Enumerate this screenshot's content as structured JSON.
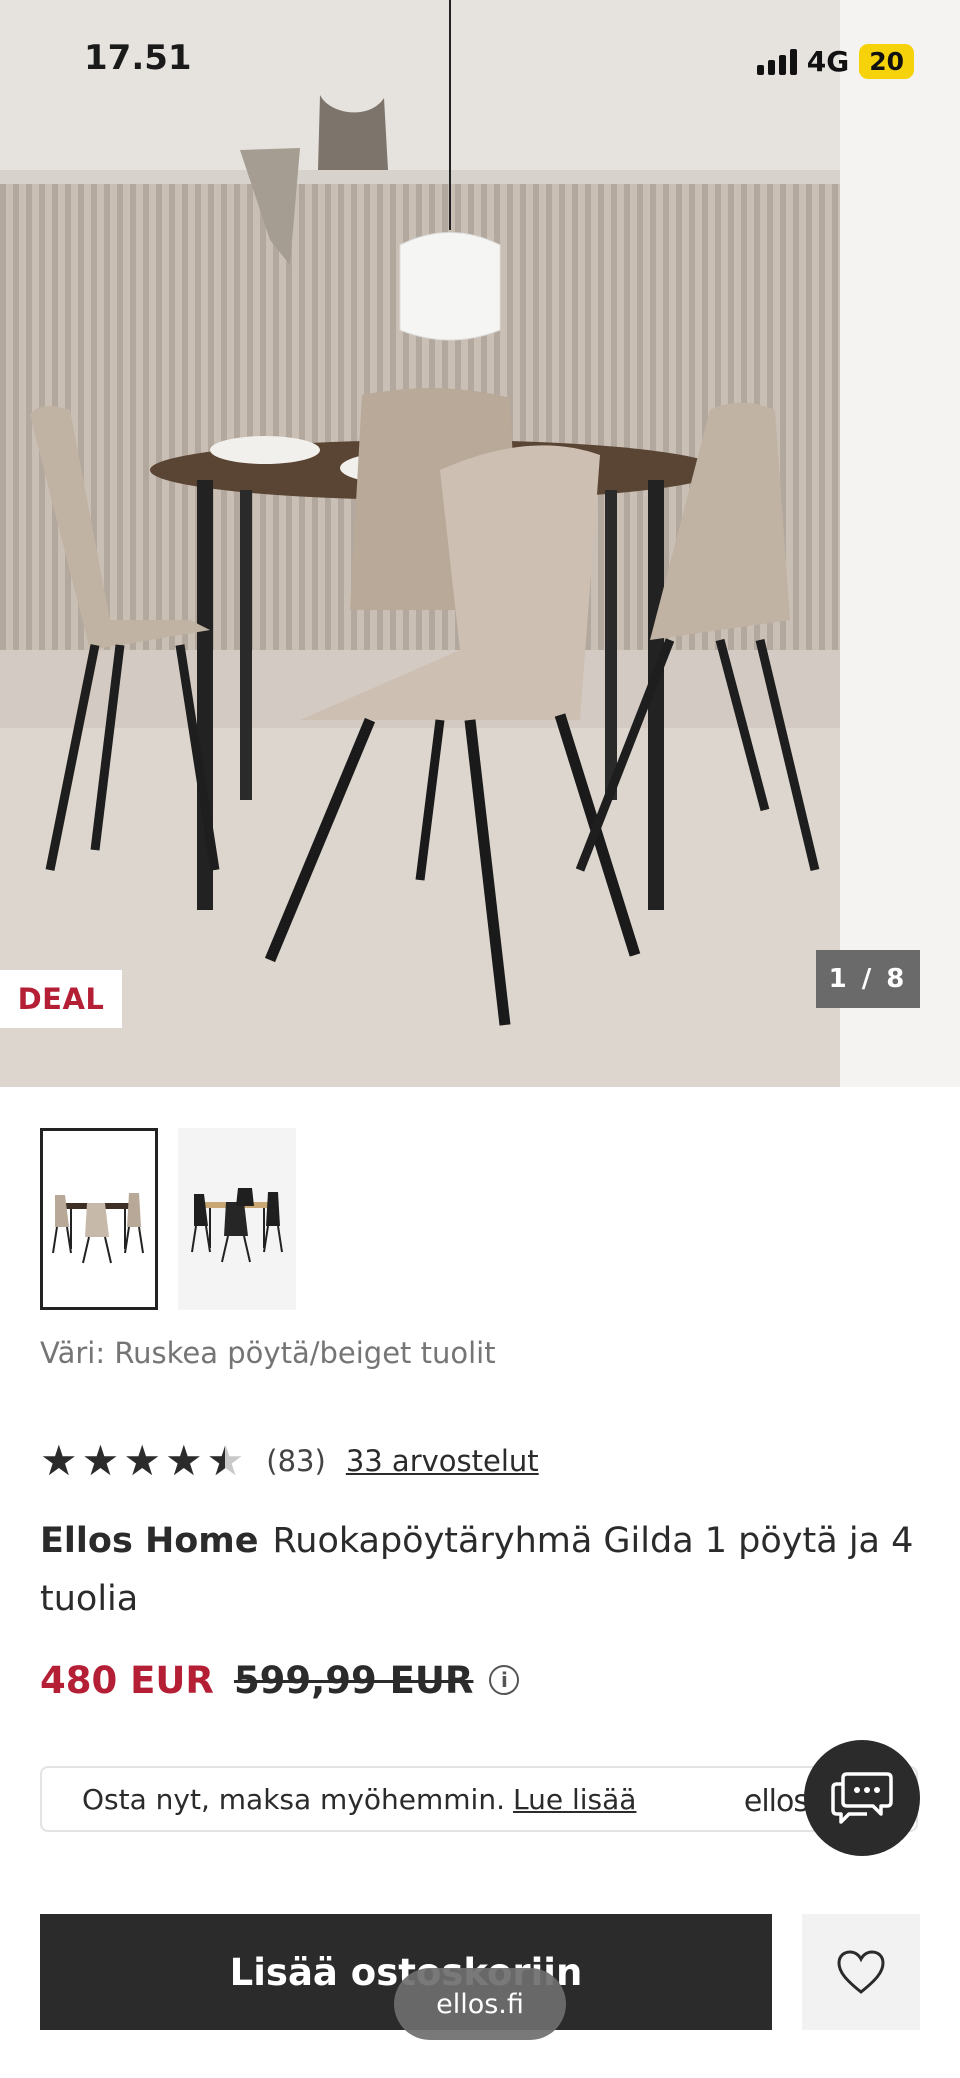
{
  "status_bar": {
    "time": "17.51",
    "network": "4G",
    "battery": "20"
  },
  "gallery": {
    "badge": "DEAL",
    "counter": "1 / 8",
    "thumbnails": [
      "beige-chairs-set",
      "black-chairs-set"
    ],
    "active_index": 0
  },
  "product": {
    "color_line": "Väri: Ruskea pöytä/beiget tuolit",
    "rating": {
      "value": 4.5,
      "max": 5,
      "count": "(83)",
      "reviews_link": "33 arvostelut"
    },
    "brand": "Ellos Home",
    "name": "Ruokapöytäryhmä Gilda 1 pöytä ja 4 tuolia",
    "price_now": "480 EUR",
    "price_old": "599,99 EUR"
  },
  "bnpl": {
    "text": "Osta nyt, maksa myöhemmin.",
    "link": "Lue lisää",
    "logo": "ellos"
  },
  "actions": {
    "add_to_cart": "Lisää ostoskoriin"
  },
  "browser": {
    "url": "ellos.fi"
  },
  "icons": {
    "info": "info-icon",
    "chat": "chat-icon",
    "wishlist": "heart-icon"
  },
  "colors": {
    "accent_red": "#b51f35",
    "dark": "#2b2b2b"
  }
}
